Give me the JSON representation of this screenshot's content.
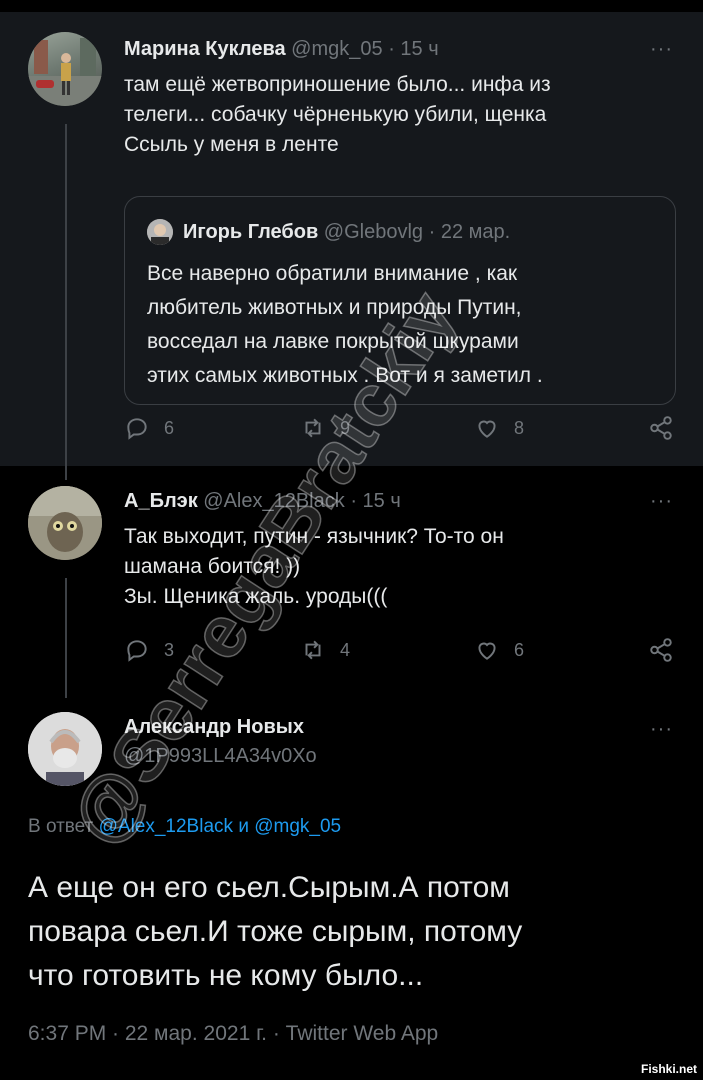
{
  "tweets": [
    {
      "name": "Марина Куклева",
      "handle": "@mgk_05",
      "time": "· 15 ч",
      "text_lines": [
        "там ещё жетвоприношение было... инфа из",
        "телеги... собачку чёрненькую убили, щенка",
        "Ссыль у меня в ленте"
      ],
      "more": "···",
      "quote": {
        "name": "Игорь Глебов",
        "handle": "@Glebovlg",
        "time": "· 22 мар.",
        "text_lines": [
          "Все наверно обратили внимание , как",
          "любитель животных и природы Путин,",
          "восседал на лавке покрытой шкурами",
          "этих самых животных . Вот и я заметил ."
        ]
      },
      "counts": {
        "replies": "6",
        "retweets": "9",
        "likes": "8"
      }
    },
    {
      "name": "А_Блэк",
      "handle": "@Alex_12Black",
      "time": "· 15 ч",
      "text_lines": [
        "Так выходит, путин - язычник? То-то он",
        "шамана боится! ))",
        "Зы. Щеника жаль. уроды((("
      ],
      "more": "···",
      "counts": {
        "replies": "3",
        "retweets": "4",
        "likes": "6"
      }
    }
  ],
  "main_tweet": {
    "name": "Александр Новых",
    "handle": "@1P993LL4A34v0Xo",
    "more": "···",
    "reply_prefix": "В ответ",
    "reply_user1": "@Alex_12Black",
    "reply_and": "и",
    "reply_user2": "@mgk_05",
    "text_lines": [
      "А еще он его сьел.Сырым.А потом",
      "повара сьел.И тоже сырым, потому",
      "что готовить не кому было..."
    ],
    "meta": "6:37 PM · 22 мар. 2021 г. · Twitter Web App"
  },
  "watermark": "@SerregaBratckiy",
  "site_watermark": "Fishki.net",
  "colors": {
    "background": "#000000",
    "card": "#15181c",
    "muted": "#71767b",
    "link": "#1d9bf0"
  },
  "icons": [
    "reply-icon",
    "retweet-icon",
    "like-icon",
    "share-icon",
    "more-icon"
  ]
}
